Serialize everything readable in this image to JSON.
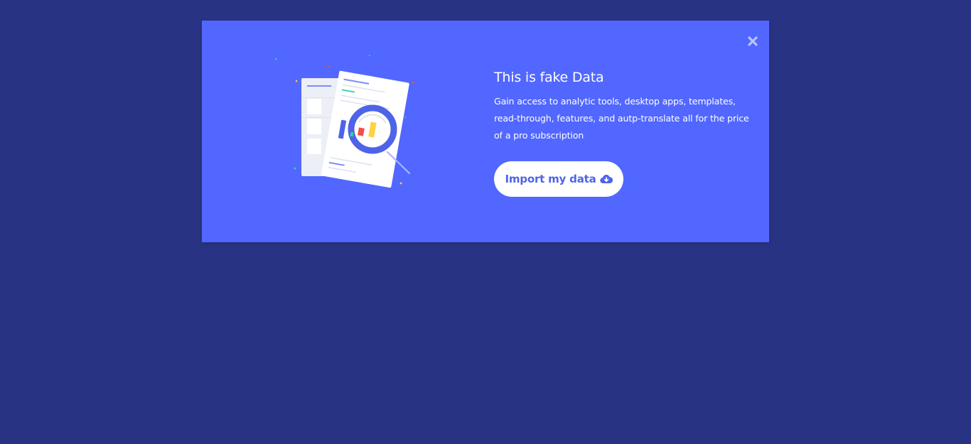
{
  "modal": {
    "close_icon": "close-icon",
    "illustration_icon": "analytics-document-illustration",
    "title": "This is fake Data",
    "description": "Gain access to analytic tools, desktop apps, templates, read-through, features, and autp-translate all for the price of a pro subscription",
    "button_label": "Import my data",
    "button_icon": "cloud-download-icon"
  },
  "colors": {
    "page_background": "#293383",
    "modal_background": "#5167ff",
    "button_background": "#ffffff",
    "button_text": "#4f63e8",
    "text": "#ffffff",
    "accent_red": "#f2504b",
    "accent_yellow": "#ffd23f",
    "accent_green": "#33d69f"
  }
}
